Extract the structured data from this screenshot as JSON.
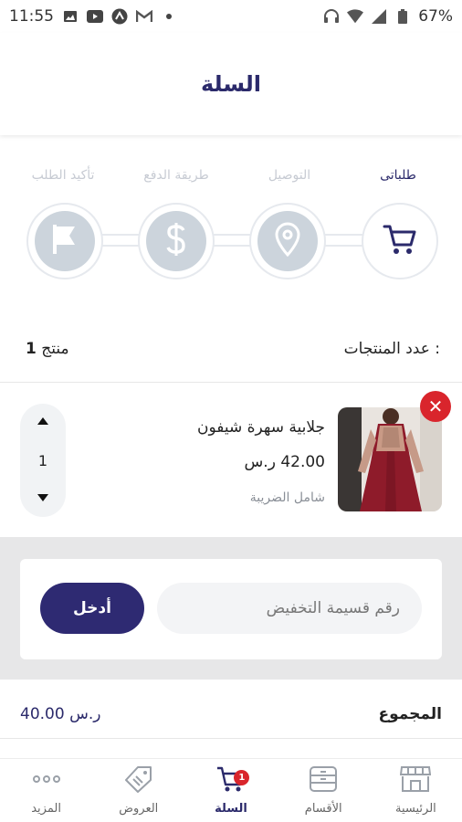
{
  "status_bar": {
    "time": "11:55",
    "battery": "67%"
  },
  "header": {
    "title": "السلة"
  },
  "steps": [
    {
      "label": "طلباتى",
      "icon": "cart-icon",
      "active": true
    },
    {
      "label": "التوصيل",
      "icon": "location-pin-icon",
      "active": false
    },
    {
      "label": "طريقة الدفع",
      "icon": "dollar-icon",
      "active": false
    },
    {
      "label": "تأكيد الطلب",
      "icon": "flag-icon",
      "active": false
    }
  ],
  "count": {
    "label": "عدد المنتجات :",
    "value": "1",
    "unit": "منتج"
  },
  "cart_item": {
    "name": "جلابية سهرة شيفون",
    "price": "42.00 ر.س",
    "tax_note": "شامل الضريبة",
    "quantity": "1"
  },
  "promo": {
    "placeholder": "رقم قسيمة التخفيض",
    "button_label": "أدخل"
  },
  "total": {
    "label": "المجموع",
    "value": "40.00 ر.س"
  },
  "bottom_nav": [
    {
      "label": "الرئيسية",
      "icon": "store-icon",
      "active": false
    },
    {
      "label": "الأقسام",
      "icon": "categories-icon",
      "active": false
    },
    {
      "label": "السلة",
      "icon": "cart-icon",
      "active": true,
      "badge": "1"
    },
    {
      "label": "العروض",
      "icon": "tag-icon",
      "active": false
    },
    {
      "label": "المزيد",
      "icon": "more-icon",
      "active": false
    }
  ],
  "colors": {
    "primary": "#2b2a6b",
    "accent": "#d9252c",
    "inactive": "#ccd4dc"
  }
}
